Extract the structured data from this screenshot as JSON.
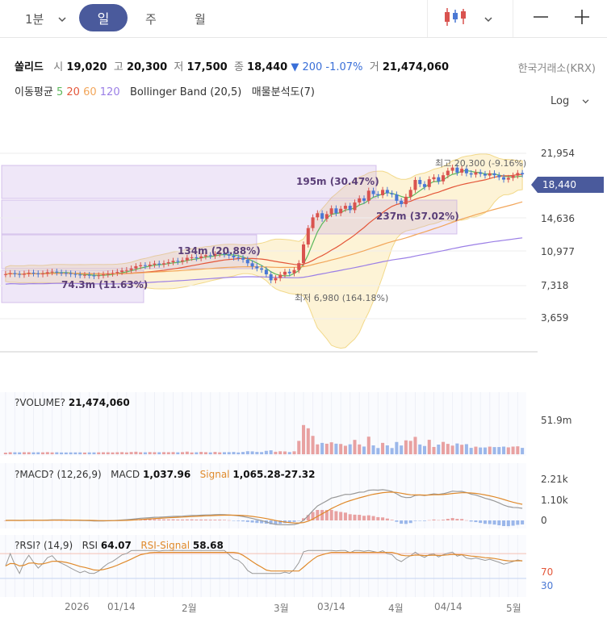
{
  "toolbar": {
    "interval": "1분",
    "tabs": [
      "일",
      "주",
      "월"
    ],
    "active_tab": "일"
  },
  "quote": {
    "name": "쏠리드",
    "open_label": "시",
    "open": "19,020",
    "high_label": "고",
    "high": "20,300",
    "low_label": "저",
    "low": "17,500",
    "close_label": "종",
    "close": "18,440",
    "change": "▼ 200 -1.07%",
    "volume_label": "거",
    "volume": "21,474,060",
    "exchange": "한국거래소(KRX)"
  },
  "indicators": {
    "ma_label": "이동평균",
    "ma_periods": [
      "5",
      "20",
      "60",
      "120"
    ],
    "ma_colors": [
      "#5cb85c",
      "#e4573a",
      "#f2a65a",
      "#9b7fe6"
    ],
    "bollinger": "Bollinger Band (20,5)",
    "volume_profile": "매물분석도(7)"
  },
  "scale": {
    "mode": "Log"
  },
  "price_axis": [
    "21,954",
    "14,636",
    "10,977",
    "7,318",
    "3,659"
  ],
  "current_price_tag": "18,440",
  "annotations": {
    "high": "최고 20,300 (-9.16%)",
    "low": "최저 6,980 (164.18%)",
    "vp": [
      "195m (30.47%)",
      "237m (37.02%)",
      "134m (20.88%)",
      "74.3m (11.63%)"
    ]
  },
  "volume_panel": {
    "title": "?VOLUME?",
    "value": "21,474,060",
    "axis": [
      "51.9m"
    ]
  },
  "macd_panel": {
    "title": "?MACD? (12,26,9)",
    "macd_label": "MACD",
    "macd": "1,037.96",
    "signal_label": "Signal",
    "signal": "1,065.28",
    "hist": "-27.32",
    "axis": [
      "2.21k",
      "1.10k",
      "0"
    ]
  },
  "rsi_panel": {
    "title": "?RSI? (14,9)",
    "rsi_label": "RSI",
    "rsi": "64.07",
    "signal_label": "RSI-Signal",
    "signal": "58.68",
    "axis": [
      "70",
      "30"
    ]
  },
  "x_axis": [
    "2026",
    "01/14",
    "2월",
    "3월",
    "03/14",
    "4월",
    "04/14",
    "5월"
  ],
  "colors": {
    "up": "#d9534f",
    "down": "#4a78d4",
    "accent": "#4a5a9c",
    "band": "#fdf3d6"
  },
  "chart_data": {
    "type": "candlestick",
    "close": [
      8050,
      8120,
      8060,
      8010,
      8080,
      8150,
      8100,
      8040,
      8090,
      8180,
      8220,
      8160,
      8130,
      8100,
      8060,
      8020,
      7980,
      8000,
      7960,
      7920,
      7970,
      8030,
      8090,
      8130,
      8200,
      8290,
      8330,
      8440,
      8600,
      8670,
      8610,
      8710,
      8790,
      8720,
      8810,
      8890,
      8990,
      8930,
      9030,
      9220,
      9260,
      9190,
      9330,
      9420,
      9370,
      9510,
      9570,
      9480,
      9380,
      9250,
      9210,
      9080,
      8810,
      8580,
      8450,
      8350,
      8040,
      7650,
      7790,
      8010,
      8210,
      8110,
      8330,
      8820,
      10300,
      11800,
      12900,
      13350,
      12750,
      13250,
      13900,
      13350,
      13850,
      14200,
      13700,
      14600,
      15100,
      14800,
      16100,
      15650,
      15500,
      16200,
      15750,
      15600,
      14800,
      14400,
      15300,
      16200,
      17600,
      17000,
      16600,
      17700,
      18000,
      17400,
      18300,
      19000,
      19500,
      18700,
      19300,
      18600,
      18400,
      18750,
      18500,
      18250,
      18600,
      18300,
      18000,
      17650,
      17900,
      18250,
      18640,
      18440
    ],
    "sma5_last": 17800,
    "sma20_last": 16500,
    "sma60_last": 12800,
    "sma120_last": 10700,
    "volume_panel_max": "51.9m",
    "macd_last": 1037.96,
    "macd_signal_last": 1065.28,
    "rsi_last": 64.07,
    "rsi_signal_last": 58.68,
    "ylim": [
      3659,
      21954
    ],
    "yscale": "log"
  }
}
